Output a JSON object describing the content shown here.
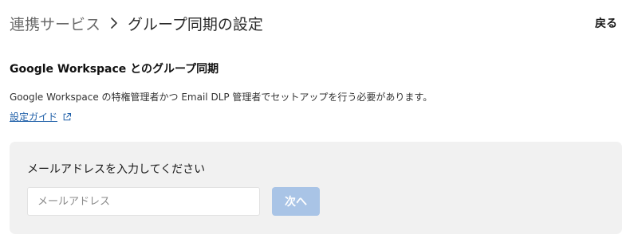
{
  "header": {
    "breadcrumb_parent": "連携サービス",
    "breadcrumb_current": "グループ同期の設定",
    "back_label": "戻る"
  },
  "section": {
    "title": "Google Workspace とのグループ同期",
    "description": "Google Workspace の特権管理者かつ Email DLP 管理者でセットアップを行う必要があります。",
    "guide_link_label": "設定ガイド"
  },
  "panel": {
    "label": "メールアドレスを入力してください",
    "email_input": {
      "value": "",
      "placeholder": "メールアドレス"
    },
    "next_button_label": "次へ"
  },
  "icons": {
    "breadcrumb_separator": "chevron-right-icon",
    "guide_link": "external-link-icon"
  },
  "colors": {
    "link": "#1f5fa8",
    "panel_background": "#f1f1f1",
    "next_button_disabled": "#a9c4e6"
  }
}
